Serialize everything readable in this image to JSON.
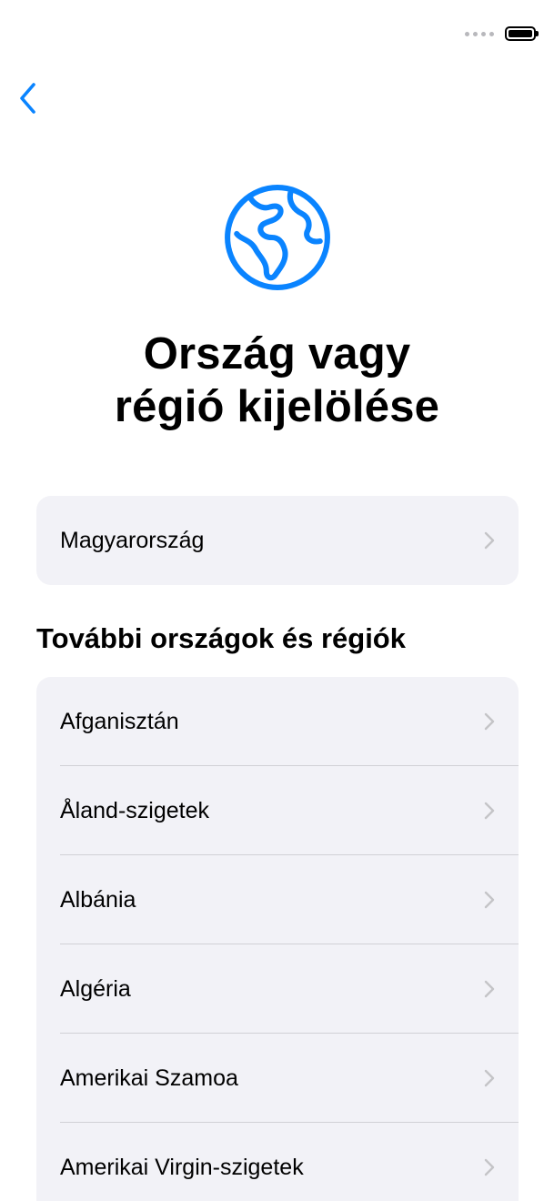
{
  "colors": {
    "accent": "#0A84FF",
    "card_background": "#F2F2F7",
    "chevron": "#C4C4C7"
  },
  "status_bar": {
    "signal_icon": "signal-dots-icon",
    "battery_icon": "battery-icon"
  },
  "nav": {
    "back_icon": "chevron-left-icon"
  },
  "header": {
    "icon": "globe-icon",
    "title_line1": "Ország vagy",
    "title_line2": "régió kijelölése"
  },
  "suggested": {
    "items": [
      {
        "label": "Magyarország"
      }
    ]
  },
  "more": {
    "header": "További országok és régiók",
    "items": [
      {
        "label": "Afganisztán"
      },
      {
        "label": "Åland-szigetek"
      },
      {
        "label": "Albánia"
      },
      {
        "label": "Algéria"
      },
      {
        "label": "Amerikai Szamoa"
      },
      {
        "label": "Amerikai Virgin-szigetek"
      }
    ]
  }
}
